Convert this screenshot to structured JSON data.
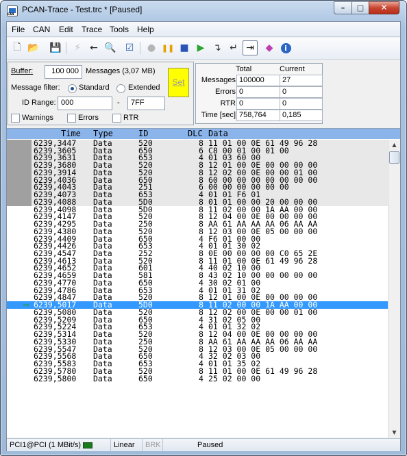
{
  "window": {
    "title": "PCAN-Trace - Test.trc * [Paused]",
    "minimize": "–",
    "maximize": "□",
    "close": "✕"
  },
  "menu": [
    {
      "label": "File"
    },
    {
      "label": "CAN"
    },
    {
      "label": "Edit"
    },
    {
      "label": "Trace"
    },
    {
      "label": "Tools"
    },
    {
      "label": "Help"
    }
  ],
  "toolbar": [
    {
      "icon": "new-file-icon",
      "glyph": "🗋"
    },
    {
      "icon": "open-folder-icon",
      "glyph": "📂"
    },
    {
      "icon": "save-icon",
      "glyph": "💾"
    },
    {
      "icon": "connect-icon",
      "glyph": "⚡"
    },
    {
      "icon": "disconnect-icon",
      "glyph": "←"
    },
    {
      "icon": "find-icon",
      "glyph": "🔍"
    },
    {
      "icon": "check-icon",
      "glyph": "☑"
    },
    {
      "icon": "record-icon",
      "glyph": "●"
    },
    {
      "icon": "pause-icon",
      "glyph": "❚❚"
    },
    {
      "icon": "stop-icon",
      "glyph": "■"
    },
    {
      "icon": "play-icon",
      "glyph": "▶"
    },
    {
      "icon": "step-icon",
      "glyph": "↴"
    },
    {
      "icon": "step-back-icon",
      "glyph": "↵"
    },
    {
      "icon": "goto-end-icon",
      "glyph": "⇥"
    },
    {
      "icon": "eraser-icon",
      "glyph": "◆"
    },
    {
      "icon": "info-icon",
      "glyph": "i"
    }
  ],
  "settings": {
    "buffer_label": "Buffer:",
    "buffer_value": "100 000",
    "buffer_info": "Messages (3,07 MB)",
    "filter_label": "Message filter:",
    "standard": "Standard",
    "extended": "Extended",
    "id_range_label": "ID Range:",
    "id_from": "000",
    "id_sep": "-",
    "id_to": "7FF",
    "set_button": "Set",
    "warnings": "Warnings",
    "errors": "Errors",
    "rtr": "RTR"
  },
  "stats": {
    "col_total": "Total",
    "col_current": "Current",
    "rows": [
      {
        "label": "Messages",
        "total": "100000",
        "current": "27"
      },
      {
        "label": "Errors",
        "total": "0",
        "current": "0"
      },
      {
        "label": "RTR",
        "total": "0",
        "current": "0"
      },
      {
        "label": "Time [sec]",
        "total": "758,764",
        "current": "0,185"
      }
    ]
  },
  "grid": {
    "headers": {
      "time": "Time",
      "type": "Type",
      "id": "ID",
      "dlc": "DLC",
      "data": "Data"
    },
    "rows": [
      {
        "time": "6239,3447",
        "type": "Data",
        "id": "520",
        "dlc": "8",
        "data": "11 01 00 0E 61 49 96 28",
        "state": "gray"
      },
      {
        "time": "6239,3605",
        "type": "Data",
        "id": "650",
        "dlc": "6",
        "data": "C8 00 01 00 01 00",
        "state": "gray"
      },
      {
        "time": "6239,3631",
        "type": "Data",
        "id": "653",
        "dlc": "4",
        "data": "01 03 60 00",
        "state": "gray"
      },
      {
        "time": "6239,3680",
        "type": "Data",
        "id": "520",
        "dlc": "8",
        "data": "12 01 00 0E 00 00 00 00",
        "state": "gray"
      },
      {
        "time": "6239,3914",
        "type": "Data",
        "id": "520",
        "dlc": "8",
        "data": "12 02 00 0E 00 00 01 00",
        "state": "gray"
      },
      {
        "time": "6239,4036",
        "type": "Data",
        "id": "650",
        "dlc": "8",
        "data": "60 00 00 00 00 00 00 00",
        "state": "gray"
      },
      {
        "time": "6239,4043",
        "type": "Data",
        "id": "251",
        "dlc": "6",
        "data": "00 00 00 00 00 00",
        "state": "gray"
      },
      {
        "time": "6239,4073",
        "type": "Data",
        "id": "653",
        "dlc": "4",
        "data": "01 01 F6 01",
        "state": "gray"
      },
      {
        "time": "6239,4088",
        "type": "Data",
        "id": "5D0",
        "dlc": "8",
        "data": "01 01 00 00 20 00 00 00",
        "state": "gray"
      },
      {
        "time": "6239,4098",
        "type": "Data",
        "id": "5D0",
        "dlc": "8",
        "data": "11 02 00 00 1A AA 00 00",
        "state": "normal"
      },
      {
        "time": "6239,4147",
        "type": "Data",
        "id": "520",
        "dlc": "8",
        "data": "12 04 00 0E 00 00 00 00",
        "state": "normal"
      },
      {
        "time": "6239,4295",
        "type": "Data",
        "id": "250",
        "dlc": "8",
        "data": "AA 61 AA AA AA 06 AA AA",
        "state": "normal"
      },
      {
        "time": "6239,4380",
        "type": "Data",
        "id": "520",
        "dlc": "8",
        "data": "12 03 00 0E 05 00 00 00",
        "state": "normal"
      },
      {
        "time": "6239,4409",
        "type": "Data",
        "id": "650",
        "dlc": "4",
        "data": "F6 01 00 00",
        "state": "normal"
      },
      {
        "time": "6239,4426",
        "type": "Data",
        "id": "653",
        "dlc": "4",
        "data": "01 01 30 02",
        "state": "normal"
      },
      {
        "time": "6239,4547",
        "type": "Data",
        "id": "252",
        "dlc": "8",
        "data": "0E 00 00 00 00 C0 65 2E",
        "state": "normal"
      },
      {
        "time": "6239,4613",
        "type": "Data",
        "id": "520",
        "dlc": "8",
        "data": "11 01 00 0E 61 49 96 28",
        "state": "normal"
      },
      {
        "time": "6239,4652",
        "type": "Data",
        "id": "601",
        "dlc": "4",
        "data": "40 02 10 00",
        "state": "normal"
      },
      {
        "time": "6239,4659",
        "type": "Data",
        "id": "581",
        "dlc": "8",
        "data": "43 02 10 00 00 00 00 00",
        "state": "normal"
      },
      {
        "time": "6239,4770",
        "type": "Data",
        "id": "650",
        "dlc": "4",
        "data": "30 02 01 00",
        "state": "normal"
      },
      {
        "time": "6239,4786",
        "type": "Data",
        "id": "653",
        "dlc": "4",
        "data": "01 01 31 02",
        "state": "normal"
      },
      {
        "time": "6239,4847",
        "type": "Data",
        "id": "520",
        "dlc": "8",
        "data": "12 01 00 0E 00 00 00 00",
        "state": "normal"
      },
      {
        "time": "6239,5017",
        "type": "Data",
        "id": "5D0",
        "dlc": "8",
        "data": "11 02 00 00 1A AA 00 00",
        "state": "selected"
      },
      {
        "time": "6239,5080",
        "type": "Data",
        "id": "520",
        "dlc": "8",
        "data": "12 02 00 0E 00 00 01 00",
        "state": "normal"
      },
      {
        "time": "6239,5209",
        "type": "Data",
        "id": "650",
        "dlc": "4",
        "data": "31 02 05 00",
        "state": "normal"
      },
      {
        "time": "6239,5224",
        "type": "Data",
        "id": "653",
        "dlc": "4",
        "data": "01 01 32 02",
        "state": "normal"
      },
      {
        "time": "6239,5314",
        "type": "Data",
        "id": "520",
        "dlc": "8",
        "data": "12 04 00 0E 00 00 00 00",
        "state": "normal"
      },
      {
        "time": "6239,5330",
        "type": "Data",
        "id": "250",
        "dlc": "8",
        "data": "AA 61 AA AA AA 06 AA AA",
        "state": "normal"
      },
      {
        "time": "6239,5547",
        "type": "Data",
        "id": "520",
        "dlc": "8",
        "data": "12 03 00 0E 05 00 00 00",
        "state": "normal"
      },
      {
        "time": "6239,5568",
        "type": "Data",
        "id": "650",
        "dlc": "4",
        "data": "32 02 03 00",
        "state": "normal"
      },
      {
        "time": "6239,5583",
        "type": "Data",
        "id": "653",
        "dlc": "4",
        "data": "01 01 35 02",
        "state": "normal"
      },
      {
        "time": "6239,5780",
        "type": "Data",
        "id": "520",
        "dlc": "8",
        "data": "11 01 00 0E 61 49 96 28",
        "state": "normal"
      },
      {
        "time": "6239,5800",
        "type": "Data",
        "id": "650",
        "dlc": "4",
        "data": "25 02 00 00",
        "state": "normal"
      }
    ],
    "selected_marker": "⇨"
  },
  "statusbar": {
    "connection": "PCI1@PCI (1 MBit/s)",
    "mode": "Linear",
    "brk": "BRK",
    "state": "Paused"
  },
  "colors": {
    "header_bg": "#8ab4ea",
    "selection": "#3399ff",
    "set_button": "#ffff00"
  }
}
